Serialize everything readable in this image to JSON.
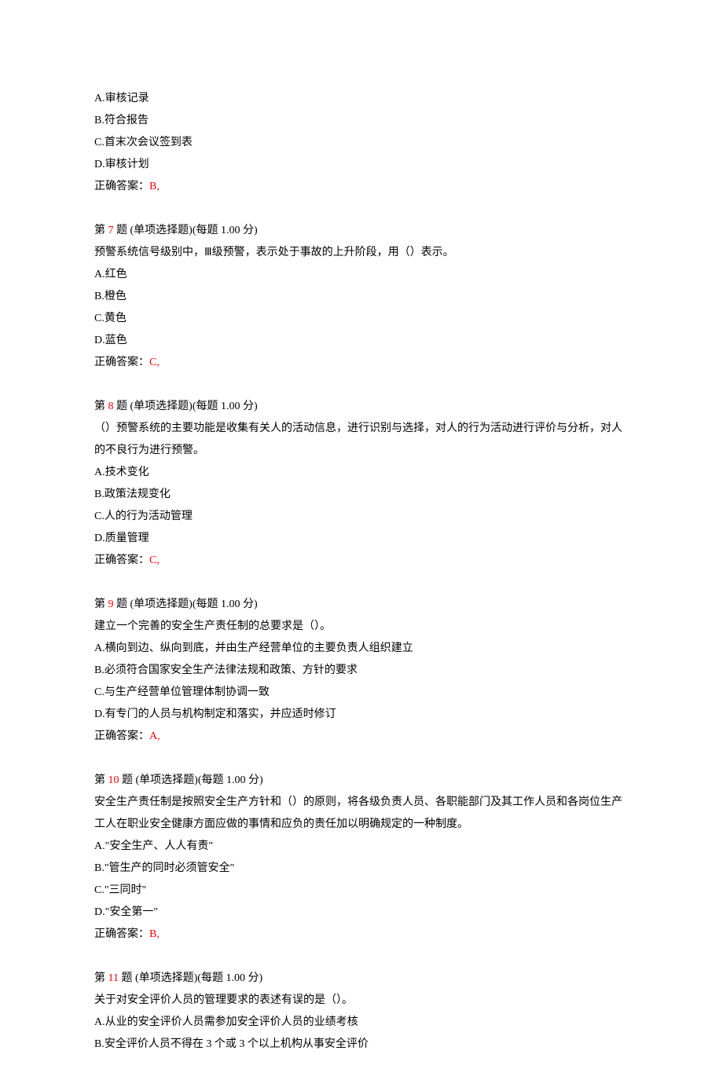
{
  "q_prefix_options": {
    "a": "A.审核记录",
    "b": "B.符合报告",
    "c": "C.首末次会议签到表",
    "d": "D.审核计划"
  },
  "q_prefix_answer_label": "正确答案：",
  "q_prefix_answer_value": "B,",
  "q7": {
    "header_pre": "第 ",
    "num": "7",
    "header_post": " 题 (单项选择题)(每题 1.00 分)",
    "stem": "预警系统信号级别中，Ⅲ级预警，表示处于事故的上升阶段，用（）表示。",
    "a": "A.红色",
    "b": "B.橙色",
    "c": "C.黄色",
    "d": "D.蓝色",
    "answer_label": "正确答案：",
    "answer_value": "C,"
  },
  "q8": {
    "header_pre": "第 ",
    "num": "8",
    "header_post": " 题 (单项选择题)(每题 1.00 分)",
    "stem": "（）预警系统的主要功能是收集有关人的活动信息，进行识别与选择，对人的行为活动进行评价与分析，对人的不良行为进行预警。",
    "a": "A.技术变化",
    "b": "B.政策法规变化",
    "c": "C.人的行为活动管理",
    "d": "D.质量管理",
    "answer_label": "正确答案：",
    "answer_value": "C,"
  },
  "q9": {
    "header_pre": "第 ",
    "num": "9",
    "header_post": " 题 (单项选择题)(每题 1.00 分)",
    "stem": "建立一个完善的安全生产责任制的总要求是（）。",
    "a": "A.横向到边、纵向到底，并由生产经营单位的主要负责人组织建立",
    "b": "B.必须符合国家安全生产法律法规和政策、方针的要求",
    "c": "C.与生产经营单位管理体制协调一致",
    "d": "D.有专门的人员与机构制定和落实，并应适时修订",
    "answer_label": "正确答案：",
    "answer_value": "A,"
  },
  "q10": {
    "header_pre": "第 ",
    "num": "10",
    "header_post": " 题 (单项选择题)(每题 1.00 分)",
    "stem": "安全生产责任制是按照安全生产方针和（）的原则，将各级负责人员、各职能部门及其工作人员和各岗位生产工人在职业安全健康方面应做的事情和应负的责任加以明确规定的一种制度。",
    "a": "A.\"安全生产、人人有责\"",
    "b": "B.\"管生产的同时必须管安全\"",
    "c": "C.\"三同时\"",
    "d": "D.\"安全第一\"",
    "answer_label": "正确答案：",
    "answer_value": "B,"
  },
  "q11": {
    "header_pre": "第 ",
    "num": "11",
    "header_post": " 题 (单项选择题)(每题 1.00 分)",
    "stem": "关于对安全评价人员的管理要求的表述有误的是（）。",
    "a": "A.从业的安全评价人员需参加安全评价人员的业绩考核",
    "b": "B.安全评价人员不得在 3 个或 3 个以上机构从事安全评价"
  }
}
